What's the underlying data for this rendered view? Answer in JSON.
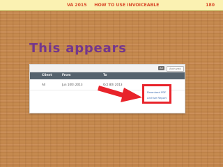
{
  "header": {
    "title": "VA 2015     HOW TO USE INVOICEABLE",
    "page_number": "180"
  },
  "slide": {
    "heading": "This appears"
  },
  "screenshot_panel": {
    "filter_buttons": {
      "all": "All",
      "archived": "Archived"
    },
    "columns": {
      "client": "Client",
      "from": "From",
      "to": "To"
    },
    "rows": [
      {
        "client": "All",
        "from": "Jun 10th 2013",
        "to": "Oct 8th 2013"
      }
    ],
    "menu": {
      "items": [
        "Download PDF",
        "Archive Report"
      ]
    }
  },
  "colors": {
    "heading": "#74378c",
    "header_text": "#d84a2a",
    "header_bg": "#fbf1b2",
    "highlight": "#e8232a",
    "table_header": "#55626d",
    "link": "#3c6eb4"
  }
}
